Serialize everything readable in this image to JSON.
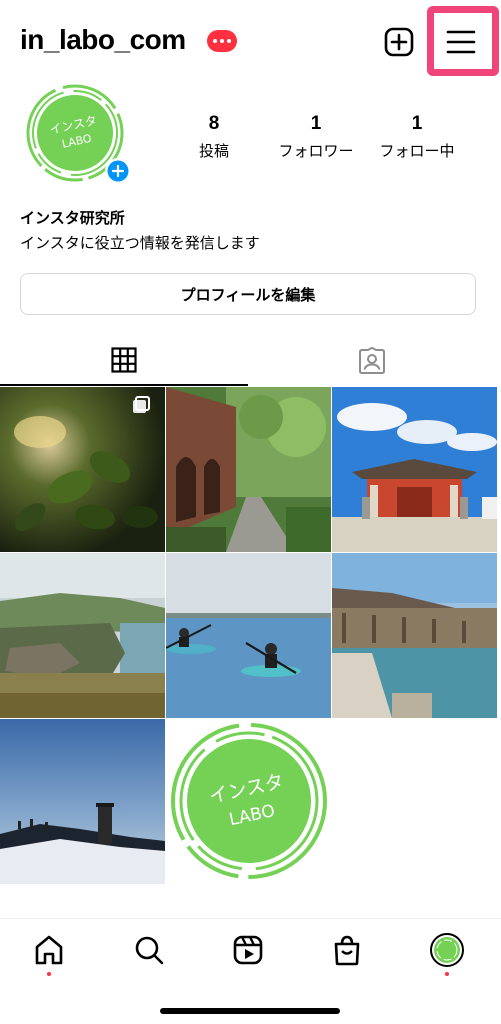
{
  "header": {
    "username": "in_labo_com",
    "create_icon": "plus-square-icon",
    "menu_icon": "hamburger-icon",
    "highlight_color": "#f0457a"
  },
  "profile": {
    "avatar_text_line1": "インスタ",
    "avatar_text_line2": "LABO",
    "brand_color": "#74d155",
    "stats": [
      {
        "value": "8",
        "label": "投稿"
      },
      {
        "value": "1",
        "label": "フォロワー"
      },
      {
        "value": "1",
        "label": "フォロー中"
      }
    ],
    "name": "インスタ研究所",
    "bio": "インスタに役立つ情報を発信します",
    "edit_button": "プロフィールを編集"
  },
  "tabs": [
    {
      "name": "grid",
      "icon": "grid-icon",
      "active": true
    },
    {
      "name": "tagged",
      "icon": "tagged-person-icon",
      "active": false
    }
  ],
  "posts": [
    {
      "subject": "leaves in dark forest",
      "multi": true
    },
    {
      "subject": "brick aqueduct and path",
      "multi": false
    },
    {
      "subject": "red shrine gate under blue sky",
      "multi": false
    },
    {
      "subject": "green coastal cliffs",
      "multi": false
    },
    {
      "subject": "two kayakers on sea",
      "multi": false
    },
    {
      "subject": "covered wooden bridge",
      "multi": false
    },
    {
      "subject": "snowy summit with stone tower",
      "multi": false
    },
    {
      "subject": "インスタ LABO logo",
      "multi": false
    }
  ],
  "logo_post": {
    "line1": "インスタ",
    "line2": "LABO"
  },
  "bottom_nav": [
    {
      "icon": "home-icon",
      "badge": true
    },
    {
      "icon": "search-icon",
      "badge": false
    },
    {
      "icon": "reels-icon",
      "badge": false
    },
    {
      "icon": "shop-icon",
      "badge": false
    },
    {
      "icon": "profile-avatar-icon",
      "badge": true
    }
  ]
}
